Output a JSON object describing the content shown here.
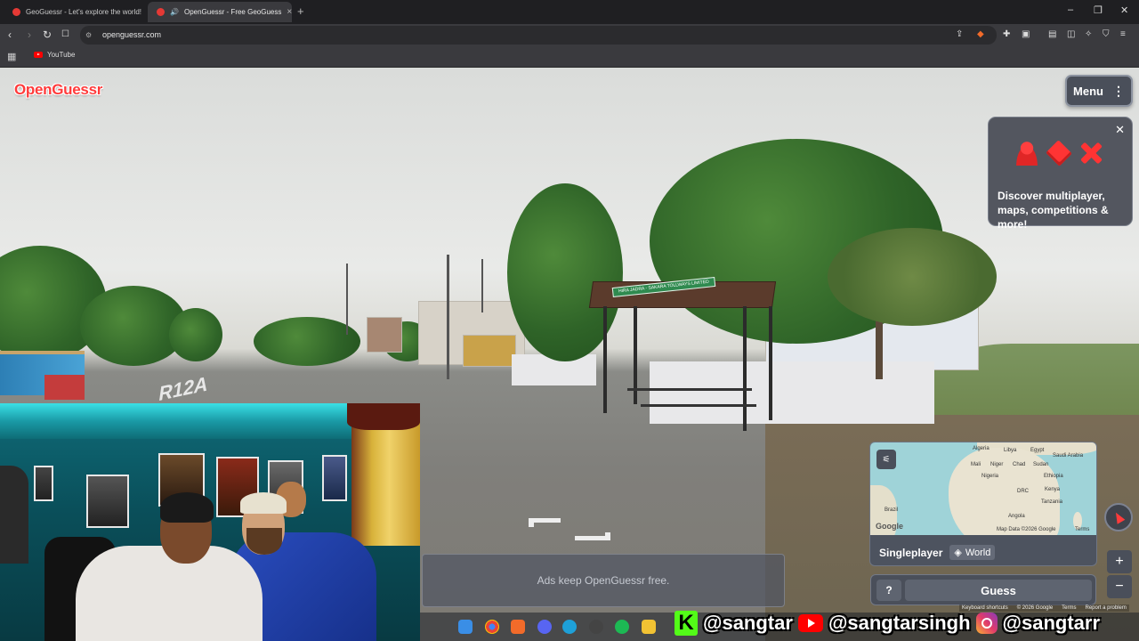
{
  "browser": {
    "tabs": [
      {
        "title": "GeoGuessr - Let's explore the world!",
        "active": false
      },
      {
        "title": "OpenGuessr - Free GeoGuess",
        "active": true
      }
    ],
    "url": "openguessr.com",
    "bookmarks": [
      {
        "label": "YouTube"
      }
    ]
  },
  "game": {
    "logo": "OpenGuessr",
    "menu_label": "Menu",
    "discover": {
      "text": "Discover multiplayer, maps, competitions & more!"
    },
    "ad_text": "Ads keep OpenGuessr free.",
    "minimap": {
      "labels": [
        "Algeria",
        "Libya",
        "Egypt",
        "Saudi Arabia",
        "Mali",
        "Niger",
        "Chad",
        "Sudan",
        "Nigeria",
        "Ethiopia",
        "DRC",
        "Kenya",
        "Tanzania",
        "Angola",
        "Brazil"
      ],
      "attribution": "Map Data ©2026 Google",
      "terms": "Terms",
      "google": "Google"
    },
    "mode": "Singleplayer",
    "map_name": "World",
    "help_label": "?",
    "guess_label": "Guess",
    "zoom_in": "+",
    "zoom_out": "−",
    "footer": [
      "Keyboard shortcuts",
      "© 2026 Google",
      "Terms",
      "Report a problem"
    ]
  },
  "scene": {
    "road_text": "R12A",
    "shelter_sign": "HIRA JADRA - SAKARA TOLLWAYS LIMITED"
  },
  "socials": {
    "kick": "@sangtar",
    "youtube": "@sangtarsingh",
    "instagram": "@sangtarr"
  },
  "colors": {
    "accent": "#ff3b3b",
    "panel": "#4a4f5a"
  }
}
